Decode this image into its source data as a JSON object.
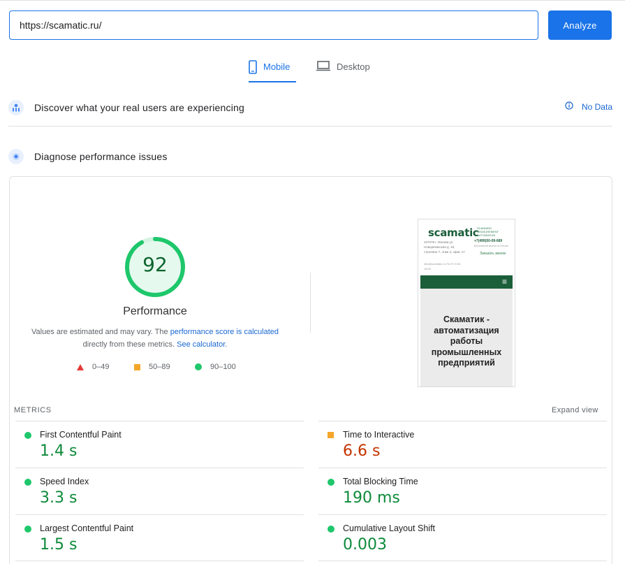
{
  "search": {
    "url_value": "https://scamatic.ru/",
    "analyze_label": "Analyze"
  },
  "tabs": [
    {
      "label": "Mobile",
      "icon": "smartphone-icon",
      "active": true
    },
    {
      "label": "Desktop",
      "icon": "laptop-icon",
      "active": false
    }
  ],
  "discover": {
    "title": "Discover what your real users are experiencing",
    "status": "No Data"
  },
  "diagnose": {
    "title": "Diagnose performance issues"
  },
  "performance": {
    "score": "92",
    "score_fraction": 0.92,
    "title": "Performance",
    "note_prefix": "Values are estimated and may vary. The ",
    "note_link1": "performance score is calculated",
    "note_middle": " directly from these metrics. ",
    "note_link2": "See calculator",
    "note_suffix": ".",
    "legend": [
      {
        "range": "0–49",
        "shape": "triangle",
        "color": "#e53935"
      },
      {
        "range": "50–89",
        "shape": "square",
        "color": "#f4a62a"
      },
      {
        "range": "90–100",
        "shape": "circle",
        "color": "#1ec76b"
      }
    ]
  },
  "screenshot": {
    "logo": "scamatic",
    "tagline": "SCANNING MEASUREMENT AUTOMATION",
    "address": "107078 г. Москва ул. Новорязанская д. 18, строение 7, этаж 3, офис 17",
    "phone": "+7(499)50-09-689",
    "phone_sub": "Бесплатный звонок по России",
    "call": "Заказать звонок",
    "email": "info@scamatic.ru\nПн-Пт 9:00-18:00",
    "hero_text": "Скаматик - автоматизация работы промышленных предприятий"
  },
  "metrics": {
    "label": "METRICS",
    "expand_label": "Expand view",
    "items": [
      {
        "name": "First Contentful Paint",
        "value": "1.4 s",
        "rating": "pass"
      },
      {
        "name": "Time to Interactive",
        "value": "6.6 s",
        "rating": "average"
      },
      {
        "name": "Speed Index",
        "value": "3.3 s",
        "rating": "pass"
      },
      {
        "name": "Total Blocking Time",
        "value": "190 ms",
        "rating": "pass"
      },
      {
        "name": "Largest Contentful Paint",
        "value": "1.5 s",
        "rating": "pass"
      },
      {
        "name": "Cumulative Layout Shift",
        "value": "0.003",
        "rating": "pass"
      }
    ]
  },
  "colors": {
    "accent": "#1a73e8",
    "pass": "#0d8a3a",
    "average": "#c33300",
    "gauge": "#1ec76b"
  }
}
